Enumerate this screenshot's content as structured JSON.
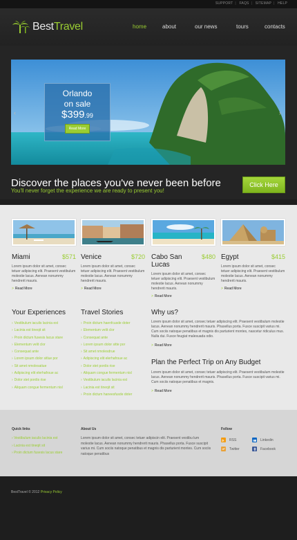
{
  "util_links": [
    "SUPPORT",
    "FAQS",
    "SITEMAP",
    "HELP"
  ],
  "brand": {
    "name_a": "Best",
    "name_b": "Travel"
  },
  "nav": [
    "home",
    "about",
    "our news",
    "tours",
    "contacts"
  ],
  "promo": {
    "city": "Orlando",
    "on_sale": "on sale",
    "price_main": "$399",
    "price_cents": ".99",
    "button": "Read More"
  },
  "headline": {
    "title": "Discover the places you've never been before",
    "subtitle": "You'll never forget the experience we are ready to present you!",
    "button": "Click Here"
  },
  "destinations": [
    {
      "name": "Miami",
      "price": "$571",
      "desc": "Lorem ipsum dolor sit amet, consec tetuer adipiscing elit. Praesent vestibulum molestie lacus. Aenean nonummy hendrerit mauris.",
      "more": "Read More"
    },
    {
      "name": "Venice",
      "price": "$720",
      "desc": "Lorem ipsum dolor sit amet, consec tetuer adipiscing elit. Praesent vestibulum molestie lacus. Aenean nonummy hendrerit mauris.",
      "more": "Read More"
    },
    {
      "name": "Cabo San Lucas",
      "price": "$480",
      "desc": "Lorem ipsum dolor sit amet, consec tetuer adipiscing elit. Praesent vestibulum molestie lacus. Aenean nonummy hendrerit mauris.",
      "more": "Read More"
    },
    {
      "name": "Egypt",
      "price": "$415",
      "desc": "Lorem ipsum dolor sit amet, consec tetuer adipiscing elit. Praesent vestibulum molestie lacus. Aenean nonummy hendrerit mauris.",
      "more": "Read More"
    }
  ],
  "experiences": {
    "title": "Your Experiences",
    "items": [
      "Vestibulum iaculis lacinia est",
      "Lacinia est tineqit sit",
      "Proin dictum fusesis lacus stare",
      "Elementum velit clor",
      "Consequat ante",
      "Lorem ipsum dolor sitlue por",
      "Sit amet nmolesatiue",
      "Adipiscing elit elerhafrsue ac",
      "Dolor stet pordis rise",
      "Aliquam congue fermentum nisl"
    ]
  },
  "stories": {
    "title": "Travel Stories",
    "items": [
      "Proin dictum haenfcusde doter",
      "Elementum velit clor",
      "Consequat ante",
      "Lorem ipsum dolor sitte por",
      "Sit amet nmolesdrue",
      "Adipiscing elit elerhafrsue ac",
      "Dolor stet pordis rise",
      "Aliquam congue fermentum nisl",
      "Vestibulum iaculis lacinia est",
      "Lacinia est tineqit sit",
      "Proin dictum haneesfusde doter"
    ]
  },
  "why": {
    "title": "Why us?",
    "text": "Lorem ipsum dolor sit amet, consec tetuer adipiscing elit. Praesent vestibulum molestie lacus. Aenean nonummy hendrerit mauris. Phasellus porta. Fusce suscipit varius mi. Cum sociis natoque penatibus et magnis dis parturient montes, nascetur ridiculus mus. Nulla dui. Fusce feugiat malesuada odio.",
    "more": "Read More"
  },
  "plan": {
    "title": "Plan the Perfect Trip on Any Budget",
    "text": "Lorem ipsum dolor sit amet, consec tetuer adipiscing elit. Praesent vestibulum molestie lacus. Aenean nonummy hendrerit mauris. Phasellus porta. Fusce suscipit varius mi. Cum sociis natoque penatibus et magnis.",
    "more": "Read More"
  },
  "footer": {
    "quick_title": "Quick links",
    "quick_links": [
      "Vestibulum iaculis lacinia est",
      "Lacinia est tineqit sit",
      "Proin dictum fusesis lacus stare"
    ],
    "about_title": "About Us",
    "about_text": "Lorem ipsum dolor sit amet, consec tetuer adipiscin elit. Praesent vestibu lum molestie lacus. Aenean nonummy hendrerit mauris. Phasellus porta. Fusce suscipit varius mi. Cum sociis natoque penatibus et magnis dis parturient montes. Cum sociis natoque penatibus",
    "follow_title": "Follow",
    "social": [
      "RSS",
      "Linkedin",
      "Twitter",
      "Facebook"
    ]
  },
  "bottom": {
    "copyright": "BestTravel © 2012",
    "privacy": "Privacy Policy"
  },
  "colors": {
    "accent": "#9acd32",
    "dark": "#1e1e1e",
    "content_bg": "#e9e9e9",
    "footer_bg": "#d6d6d6"
  }
}
